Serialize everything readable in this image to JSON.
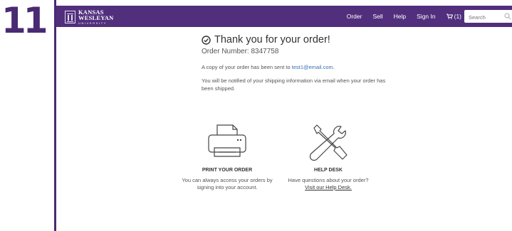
{
  "step": {
    "number": "11"
  },
  "brand": {
    "line1": "KANSAS",
    "line2": "WESLEYAN",
    "line3": "UNIVERSITY"
  },
  "nav": {
    "order": "Order",
    "sell": "Sell",
    "help": "Help",
    "sign_in": "Sign In",
    "cart_label": "(1)",
    "search_placeholder": "Search"
  },
  "confirmation": {
    "title": "Thank you for your order!",
    "order_number": "Order Number: 8347758",
    "copy_prefix": "A copy of your order has been sent to ",
    "email": "test1@email.com",
    "copy_suffix": ".",
    "notify": "You will be notified of your shipping information via email when your order has been shipped."
  },
  "actions": {
    "print": {
      "heading": "PRINT YOUR ORDER",
      "text": "You can always access your orders by signing into your account."
    },
    "help": {
      "heading": "HELP DESK",
      "text": "Have questions about your order?",
      "link": "Visit our Help Desk."
    }
  },
  "colors": {
    "brand_purple": "#512f7d",
    "link_blue": "#3a6fb0"
  }
}
